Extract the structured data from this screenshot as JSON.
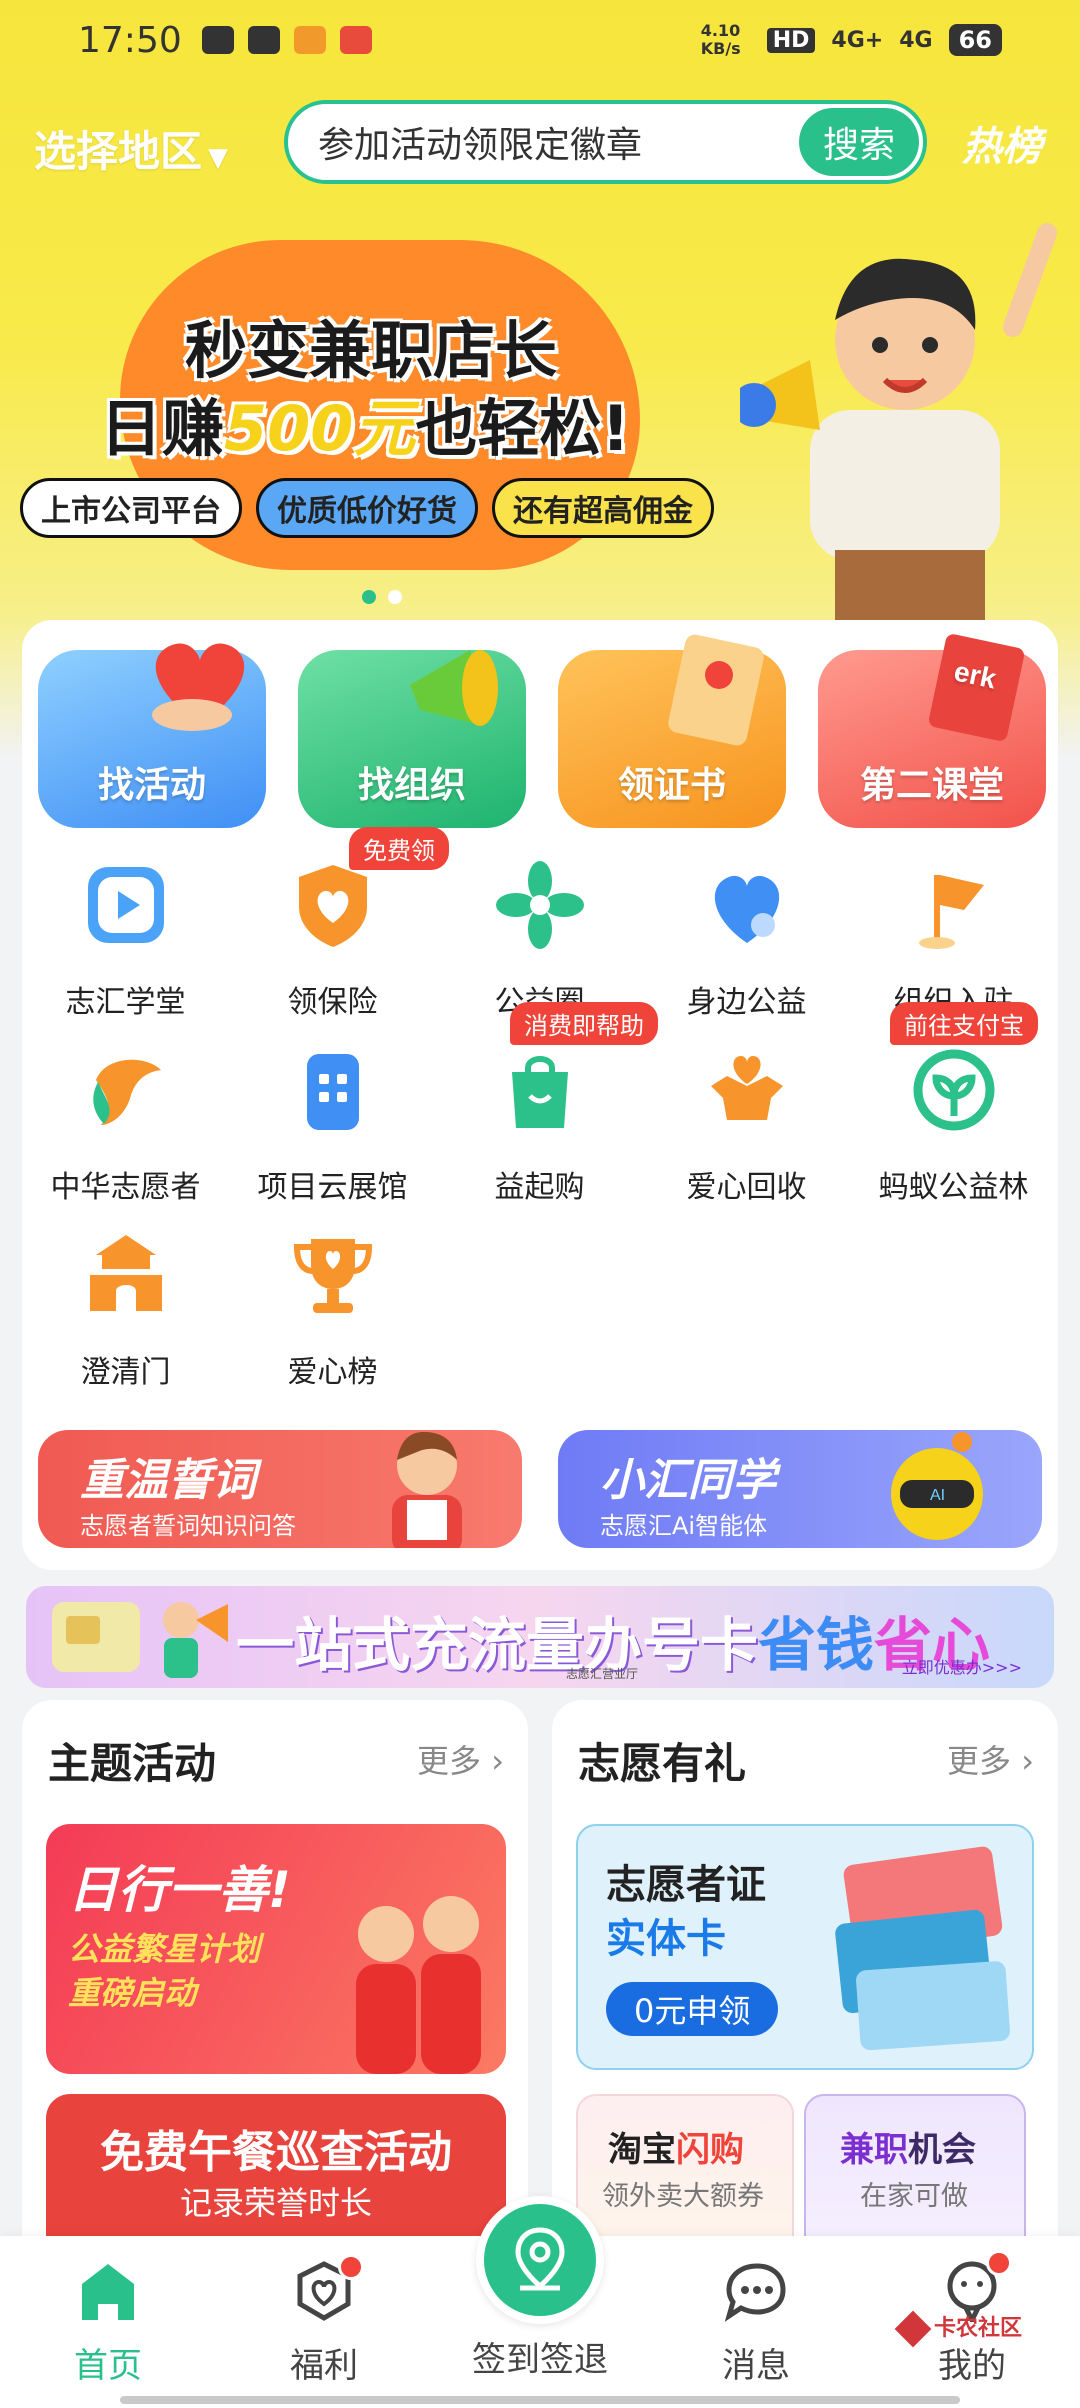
{
  "status": {
    "time": "17:50",
    "net_speed": "4.10 KB/s",
    "hd": "HD",
    "sig1": "4G+",
    "sig2": "4G",
    "battery": "66"
  },
  "topbar": {
    "region": "选择地区",
    "search_placeholder": "参加活动领限定徽章",
    "search_button": "搜索",
    "hot": "热榜"
  },
  "banner": {
    "line1": "秒变兼职店长",
    "line2_prefix": "日赚",
    "line2_em": "500元",
    "line2_suffix": "也轻松!",
    "pills": [
      "上市公司平台",
      "优质低价好货",
      "还有超高佣金"
    ]
  },
  "big_tiles": [
    "找活动",
    "找组织",
    "领证书",
    "第二课堂"
  ],
  "grid": [
    {
      "label": "志汇学堂",
      "icon": "play-icon"
    },
    {
      "label": "领保险",
      "icon": "shield-heart-icon",
      "tag": "免费领"
    },
    {
      "label": "公益圈",
      "icon": "pinwheel-icon"
    },
    {
      "label": "身边公益",
      "icon": "heart-location-icon"
    },
    {
      "label": "组织入驻",
      "icon": "flag-icon"
    },
    {
      "label": "中华志愿者",
      "icon": "bird-logo-icon"
    },
    {
      "label": "项目云展馆",
      "icon": "building-icon"
    },
    {
      "label": "益起购",
      "icon": "shopping-bag-icon",
      "tag": "消费即帮助"
    },
    {
      "label": "爱心回收",
      "icon": "box-heart-icon"
    },
    {
      "label": "蚂蚁公益林",
      "icon": "sprout-icon",
      "tag": "前往支付宝"
    },
    {
      "label": "澄清门",
      "icon": "gate-icon"
    },
    {
      "label": "爱心榜",
      "icon": "trophy-icon"
    }
  ],
  "promos": [
    {
      "title": "重温誓词",
      "sub": "志愿者誓词知识问答"
    },
    {
      "title": "小汇同学",
      "sub": "志愿汇Ai智能体"
    }
  ],
  "adbar": {
    "text_a": "一站式充流量办号卡",
    "text_b": "省钱",
    "text_c": "省心",
    "sub": "立即优惠办>>>",
    "mid": "志愿汇营业厅"
  },
  "theme": {
    "title": "主题活动",
    "more": "更多",
    "card1_a": "日行一善!",
    "card1_b": "公益繁星计划",
    "card1_c": "重磅启动",
    "card2_a": "免费午餐巡查活动",
    "card2_b": "记录荣誉时长"
  },
  "gift": {
    "title": "志愿有礼",
    "more": "更多",
    "card_title": "志愿者证",
    "card_title2": "实体卡",
    "card_btn": "0元申领",
    "mini1_a": "淘宝",
    "mini1_b": "闪购",
    "mini1_sub": "领外卖大额券",
    "mini2_a": "兼职",
    "mini2_b": "机会",
    "mini2_sub": "在家可做"
  },
  "nav": [
    "首页",
    "福利",
    "签到签退",
    "消息",
    "我的"
  ],
  "watermark": "卡农社区",
  "colors": {
    "accent": "#2ac08c",
    "hero_yellow": "#f6e53c",
    "alert_red": "#f0443a"
  }
}
